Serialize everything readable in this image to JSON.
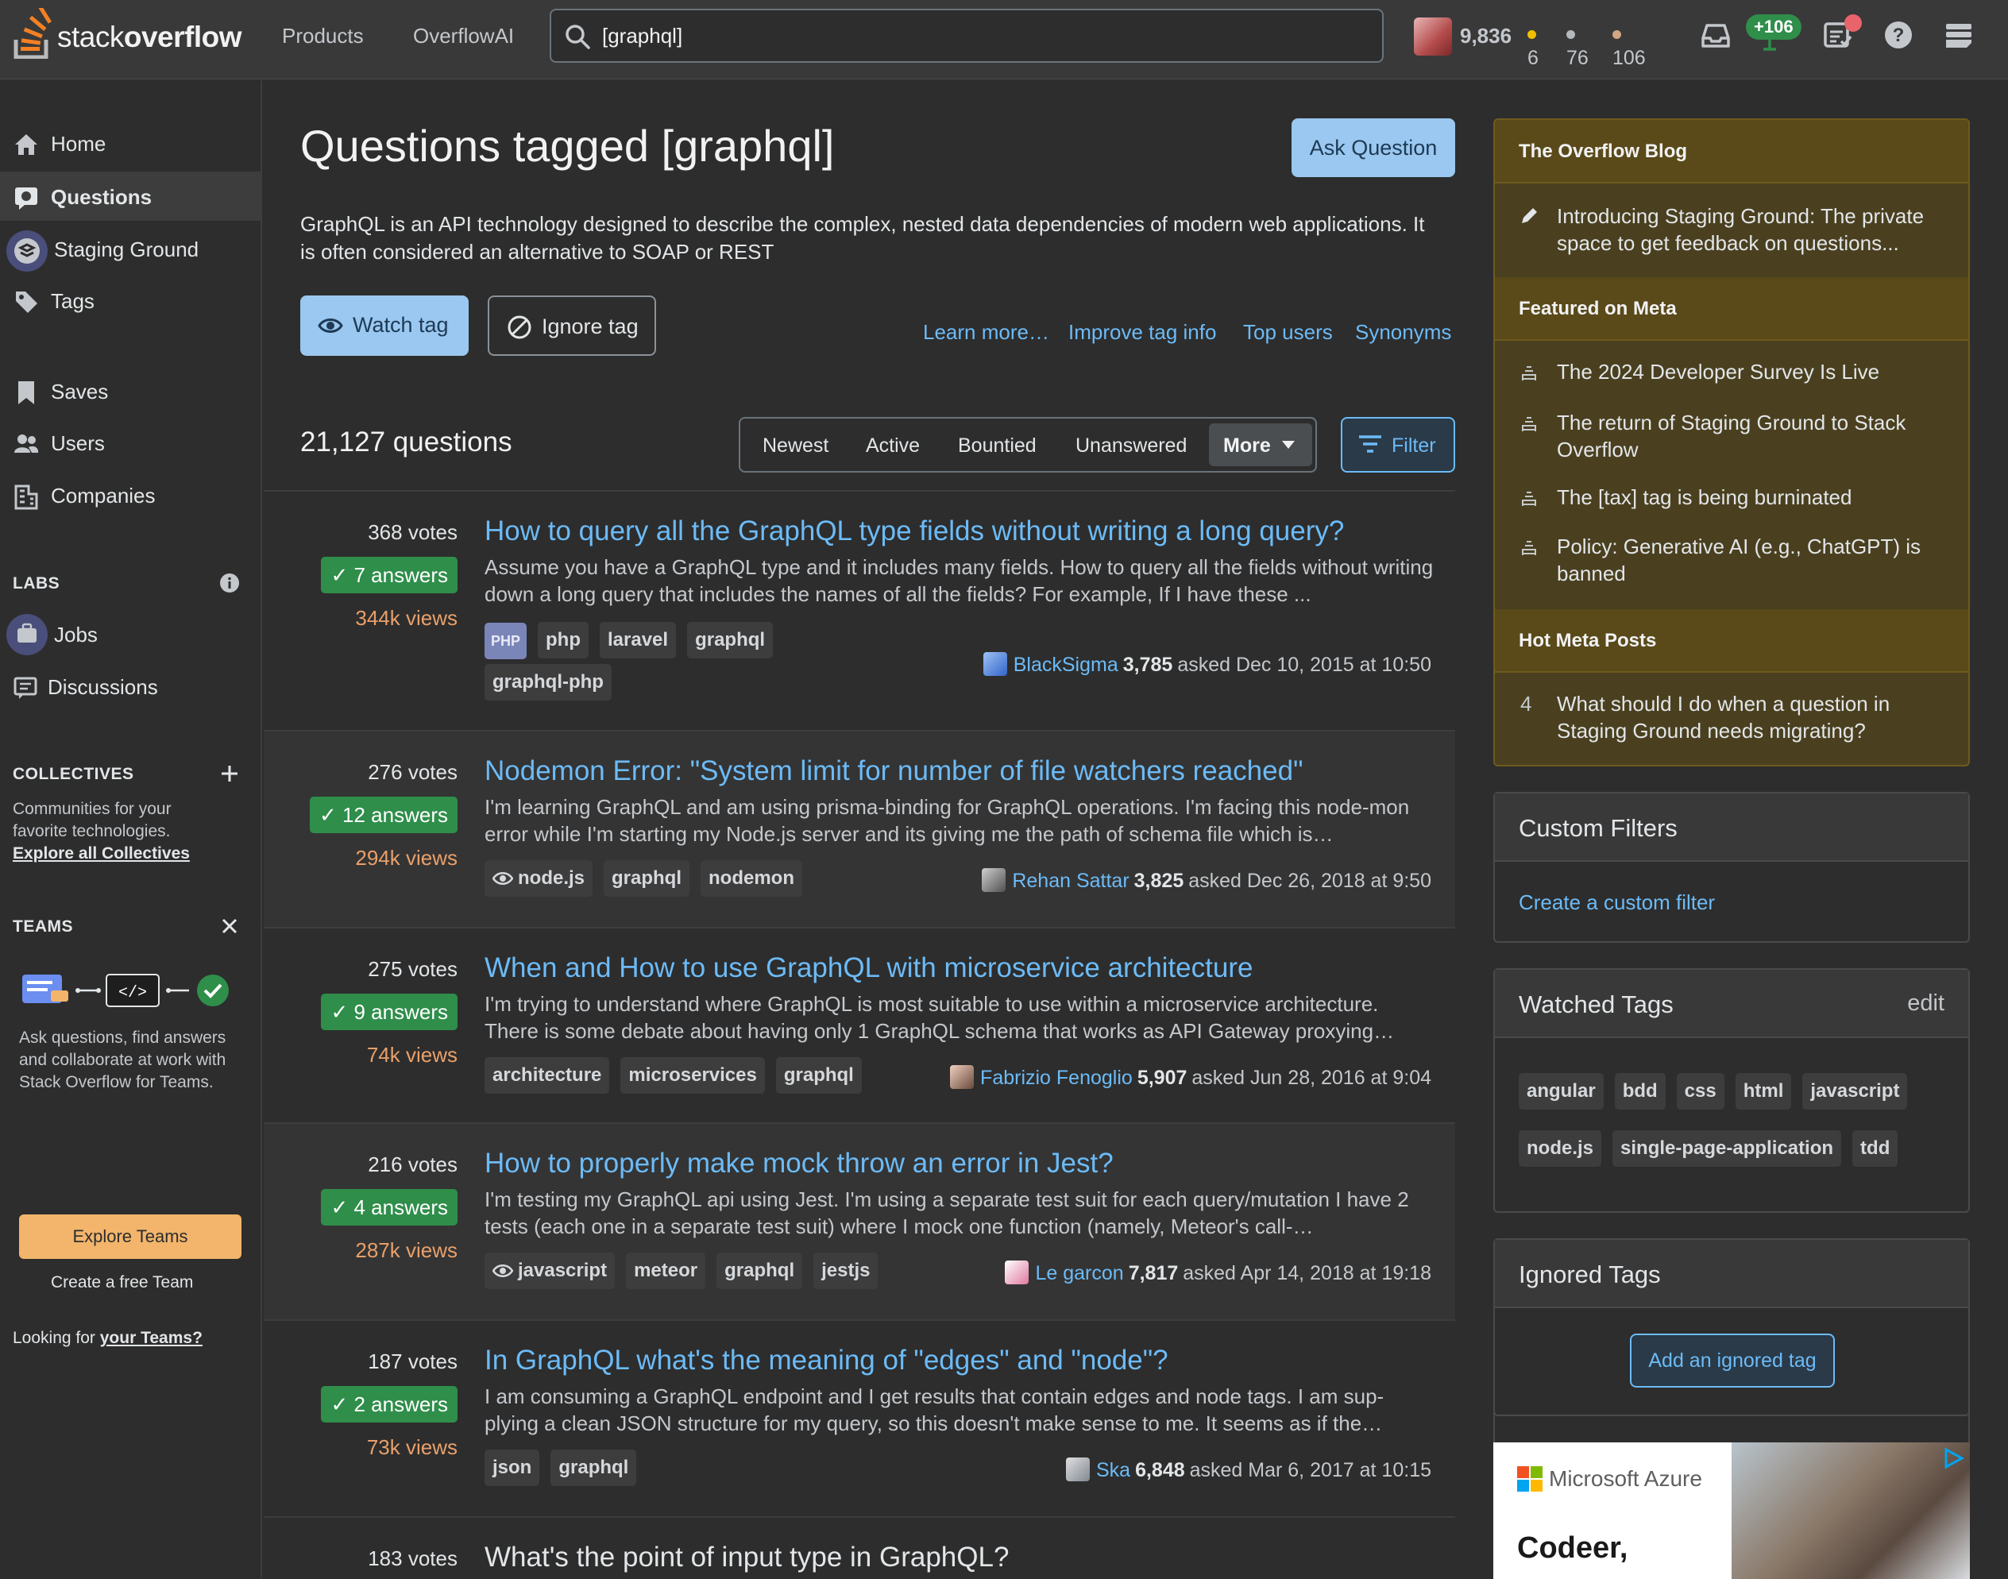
{
  "topbar": {
    "logo_text_a": "stack",
    "logo_text_b": "overflow",
    "nav": [
      "Products",
      "OverflowAI"
    ],
    "search_value": "[graphql]",
    "reputation": "9,836",
    "gold": "6",
    "silver": "76",
    "bronze": "106",
    "rep_change": "+106",
    "colors": {
      "gold": "#f0c000",
      "silver": "#b4b8bc",
      "bronze": "#d1a684",
      "accent": "#2f8e4a"
    },
    "icons": [
      "inbox-icon",
      "achievements-icon",
      "review-queue-icon",
      "help-icon",
      "site-switcher-icon"
    ]
  },
  "leftnav": {
    "items": [
      {
        "label": "Home",
        "icon": "home-icon"
      },
      {
        "label": "Questions",
        "icon": "questions-icon",
        "active": true
      },
      {
        "label": "Staging Ground",
        "icon": "staging-ground-icon"
      },
      {
        "label": "Tags",
        "icon": "tag-icon"
      },
      {
        "label": "Saves",
        "icon": "bookmark-icon"
      },
      {
        "label": "Users",
        "icon": "users-icon"
      },
      {
        "label": "Companies",
        "icon": "companies-icon"
      }
    ],
    "labs_heading": "LABS",
    "labs_items": [
      {
        "label": "Jobs",
        "icon": "jobs-icon"
      },
      {
        "label": "Discussions",
        "icon": "discussions-icon"
      }
    ],
    "collectives_heading": "COLLECTIVES",
    "collectives_note": "Communities for your favorite technologies.",
    "collectives_link": "Explore all Collectives",
    "teams_heading": "TEAMS",
    "teams_note": "Ask questions, find answers and collaborate at work with Stack Overflow for Teams.",
    "explore_teams": "Explore Teams",
    "create_team": "Create a free Team",
    "looking_for": "Looking for",
    "your_teams": "your Teams?"
  },
  "main": {
    "title": "Questions tagged [graphql]",
    "ask_button": "Ask Question",
    "description": "GraphQL is an API technology designed to describe the complex, nested data dependencies of modern web applications. It is often considered an alternative to SOAP or REST",
    "watch_tag": "Watch tag",
    "ignore_tag": "Ignore tag",
    "links": [
      "Learn more…",
      "Improve tag info",
      "Top users",
      "Synonyms"
    ],
    "question_count": "21,127 questions",
    "sort_tabs": [
      "Newest",
      "Active",
      "Bountied",
      "Unanswered"
    ],
    "sort_more": "More",
    "filter": "Filter",
    "questions": [
      {
        "votes": "368",
        "votes_label": "votes",
        "answers": "7 answers",
        "views": "344k views",
        "title": "How to query all the GraphQL type fields without writing a long query?",
        "excerpt": "Assume you have a GraphQL type and it includes many fields. How to query all the fields without writing down a long query that includes the names of all the fields? For example, If I have these ...",
        "tags": [
          "php",
          "laravel",
          "graphql",
          "graphql-php"
        ],
        "user": "BlackSigma",
        "rep": "3,785",
        "asked": "asked Dec 10, 2015 at 10:50"
      },
      {
        "votes": "276",
        "votes_label": "votes",
        "answers": "12 answers",
        "views": "294k views",
        "title": "Nodemon Error: \"System limit for number of file watchers reached\"",
        "excerpt": "I'm learning GraphQL and am using prisma-binding for GraphQL operations. I'm facing this node-mon error while I'm starting my Node.js server and its giving me the path of schema file which is…",
        "tags": [
          "node.js",
          "graphql",
          "nodemon"
        ],
        "user": "Rehan Sattar",
        "rep": "3,825",
        "asked": "asked Dec 26, 2018 at 9:50"
      },
      {
        "votes": "275",
        "votes_label": "votes",
        "answers": "9 answers",
        "views": "74k views",
        "title": "When and How to use GraphQL with microservice architecture",
        "excerpt": "I'm trying to understand where GraphQL is most suitable to use within a microservice architecture. There is some debate about having only 1 GraphQL schema that works as API Gateway proxying…",
        "tags": [
          "architecture",
          "microservices",
          "graphql"
        ],
        "user": "Fabrizio Fenoglio",
        "rep": "5,907",
        "asked": "asked Jun 28, 2016 at 9:04"
      },
      {
        "votes": "216",
        "votes_label": "votes",
        "answers": "4 answers",
        "views": "287k views",
        "title": "How to properly make mock throw an error in Jest?",
        "excerpt": "I'm testing my GraphQL api using Jest. I'm using a separate test suit for each query/mutation I have 2 tests (each one in a separate test suit) where I mock one function (namely, Meteor's call-…",
        "tags": [
          "javascript",
          "meteor",
          "graphql",
          "jestjs"
        ],
        "user": "Le garcon",
        "rep": "7,817",
        "asked": "asked Apr 14, 2018 at 19:18"
      },
      {
        "votes": "187",
        "votes_label": "votes",
        "answers": "2 answers",
        "views": "73k views",
        "title": "In GraphQL what's the meaning of \"edges\" and \"node\"?",
        "excerpt": "I am consuming a GraphQL endpoint and I get results that contain edges and node tags. I am sup-plying a clean JSON structure for my query, so this doesn't make sense to me. It seems as if the…",
        "tags": [
          "json",
          "graphql"
        ],
        "user": "Ska",
        "rep": "6,848",
        "asked": "asked Mar 6, 2017 at 10:15"
      },
      {
        "votes": "183",
        "votes_label": "votes",
        "title": "What's the point of input type in GraphQL?"
      }
    ]
  },
  "rightbar": {
    "blog_heading": "The Overflow Blog",
    "blog_item": "Introducing Staging Ground: The private space to get feedback on questions...",
    "meta_heading": "Featured on Meta",
    "meta_items": [
      "The 2024 Developer Survey Is Live",
      "The return of Staging Ground to Stack Overflow",
      "The [tax] tag is being burninated",
      "Policy: Generative AI (e.g., ChatGPT) is banned"
    ],
    "hot_heading": "Hot Meta Posts",
    "hot_count": "4",
    "hot_item": "What should I do when a question in Staging Ground needs migrating?",
    "custom_filters_heading": "Custom Filters",
    "custom_filter_link": "Create a custom filter",
    "watched_heading": "Watched Tags",
    "watched_edit": "edit",
    "watched_tags": [
      "angular",
      "bdd",
      "css",
      "html",
      "javascript",
      "node.js",
      "single-page-application",
      "tdd"
    ],
    "ignored_heading": "Ignored Tags",
    "ignored_button": "Add an ignored tag",
    "ad_brand": "Microsoft Azure",
    "ad_text": "Codeer,"
  }
}
